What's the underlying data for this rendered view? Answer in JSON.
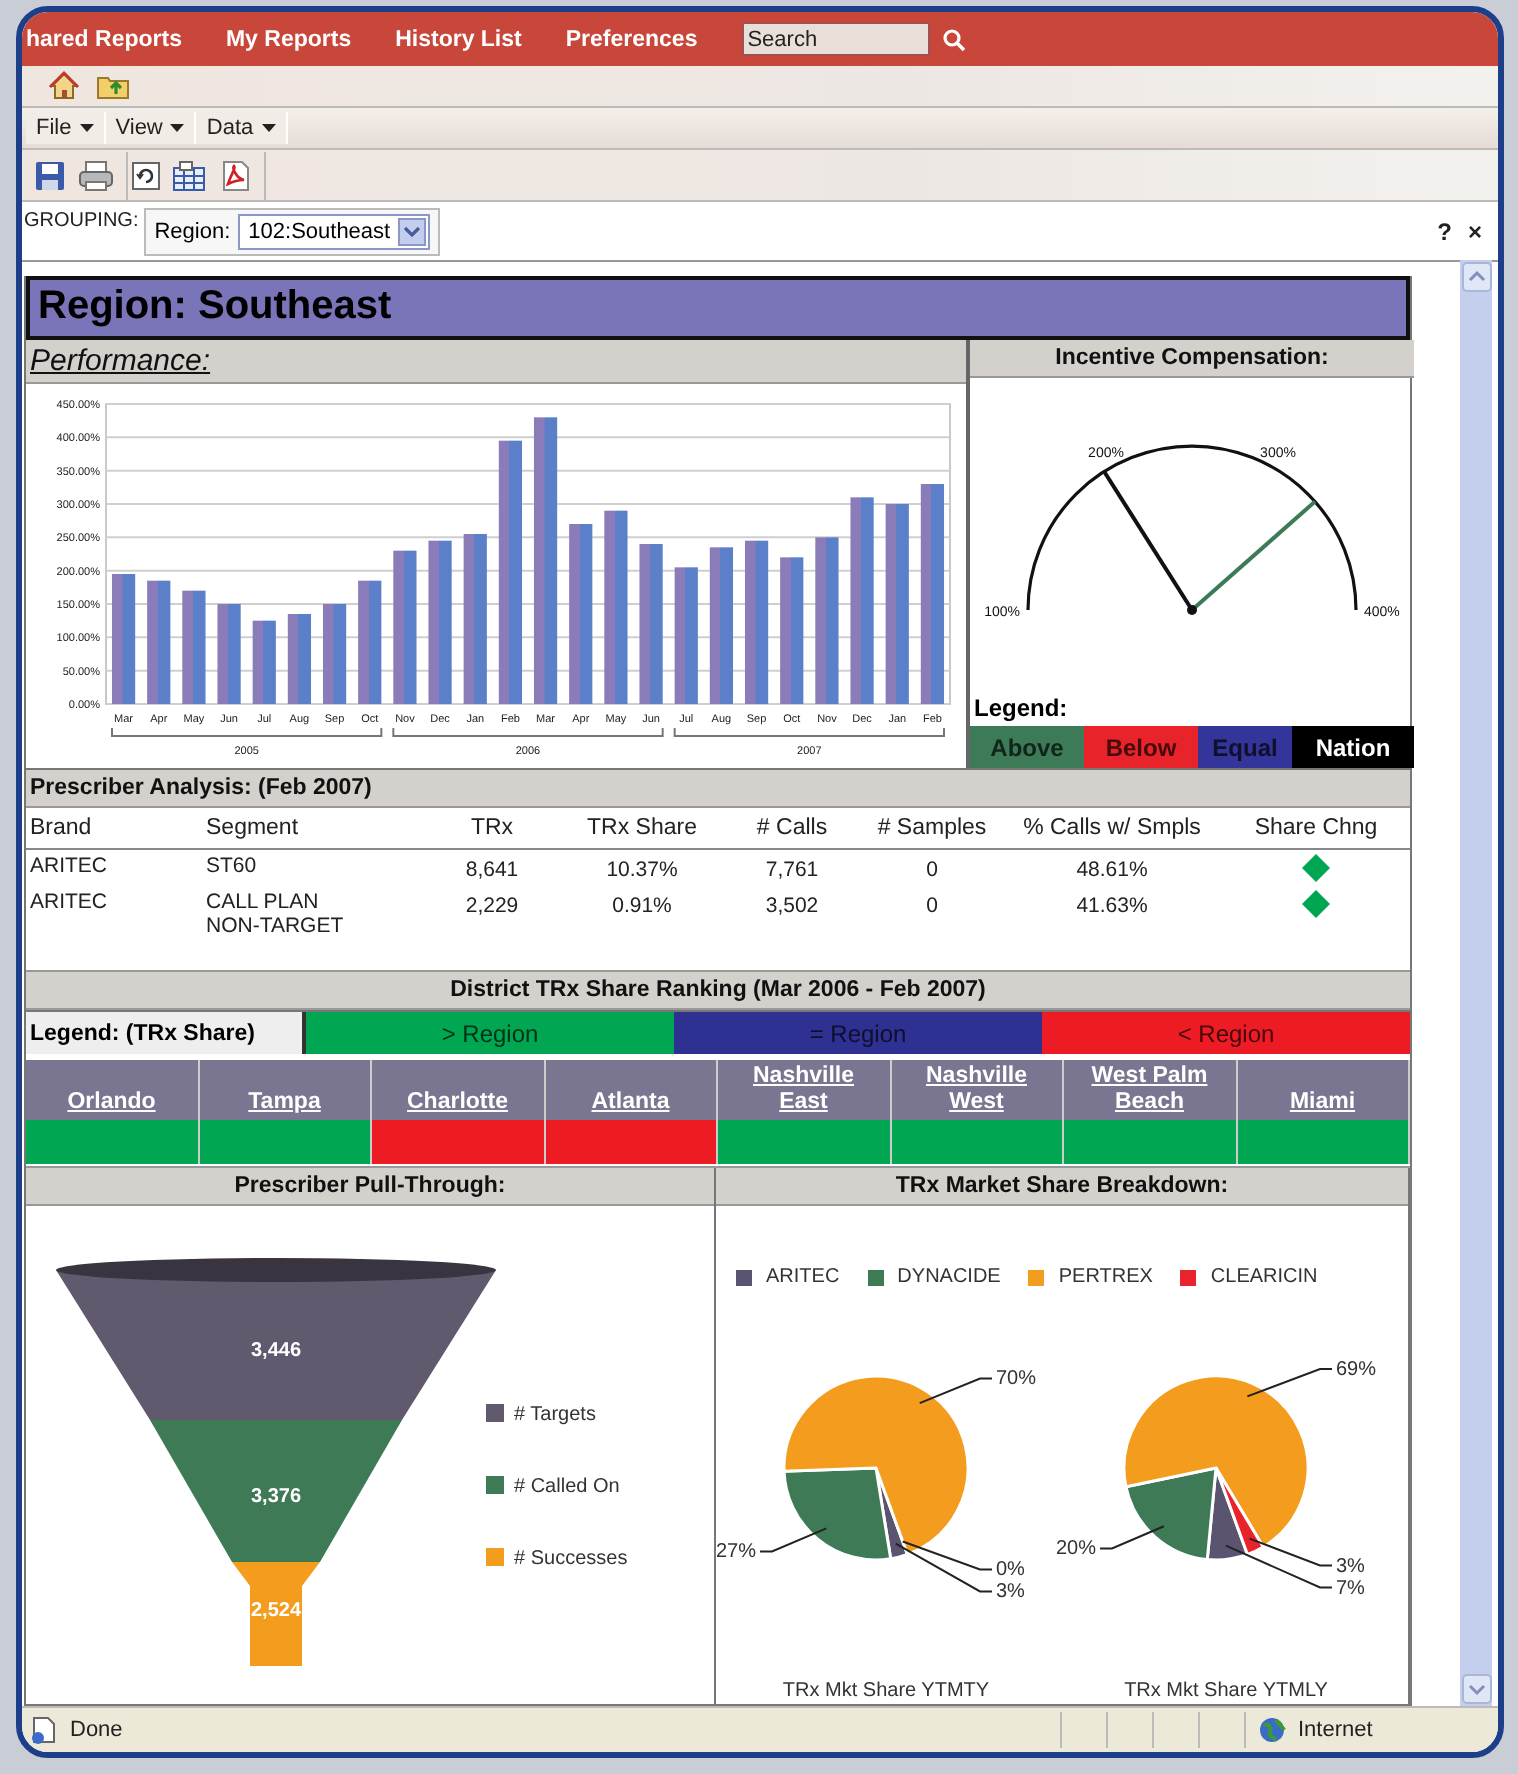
{
  "nav": {
    "tabs": [
      "hared Reports",
      "My Reports",
      "History List",
      "Preferences"
    ],
    "search": {
      "value": "Search"
    }
  },
  "menus": [
    "File",
    "View",
    "Data"
  ],
  "grouping": {
    "label": "GROUPING:",
    "field_label": "Region:",
    "value": "102:Southeast"
  },
  "panel_controls": [
    "?",
    "×"
  ],
  "report": {
    "title": "Region: Southeast",
    "performance": {
      "title": "Performance:",
      "chart_data": {
        "type": "bar",
        "categories": [
          "Mar",
          "Apr",
          "May",
          "Jun",
          "Jul",
          "Aug",
          "Sep",
          "Oct",
          "Nov",
          "Dec",
          "Jan",
          "Feb",
          "Mar",
          "Apr",
          "May",
          "Jun",
          "Jul",
          "Aug",
          "Sep",
          "Oct",
          "Nov",
          "Dec",
          "Jan",
          "Feb"
        ],
        "grid": true,
        "series": [
          {
            "color": "#5b7fc8",
            "values": [
              195,
              185,
              170,
              150,
              125,
              135,
              150,
              185,
              230,
              245,
              255,
              395,
              430,
              270,
              290,
              240,
              205,
              235,
              245,
              220,
              250,
              310,
              300,
              330
            ]
          }
        ],
        "ylim": [
          0,
          450
        ],
        "yticks": [
          {
            "value": 0,
            "label": "0.00%"
          },
          {
            "value": 50,
            "label": "50.00%"
          },
          {
            "value": 100,
            "label": "100.00%"
          },
          {
            "value": 150,
            "label": "150.00%"
          },
          {
            "value": 200,
            "label": "200.00%"
          },
          {
            "value": 250,
            "label": "250.00%"
          },
          {
            "value": 300,
            "label": "300.00%"
          },
          {
            "value": 350,
            "label": "350.00%"
          },
          {
            "value": 400,
            "label": "400.00%"
          },
          {
            "value": 450,
            "label": "450.00%"
          }
        ],
        "annotations": [
          "2005",
          "2006",
          "2007"
        ]
      }
    },
    "incentive": {
      "title": "Incentive Compensation:",
      "gauge": {
        "ticks": [
          "100%",
          "200%",
          "300%",
          "400%"
        ],
        "needles": [
          {
            "level": 0.32,
            "color": "#111111"
          },
          {
            "level": 0.77,
            "color": "#3d7a57"
          }
        ]
      },
      "legend_title": "Legend:",
      "legend": [
        {
          "label": "Above",
          "color": "#3d7a57"
        },
        {
          "label": "Below",
          "color": "#e8242a"
        },
        {
          "label": "Equal",
          "color": "#34359a"
        },
        {
          "label": "Nation",
          "color": "#000000"
        }
      ]
    },
    "prescriber": {
      "title": "Prescriber Analysis: (Feb 2007)",
      "columns": [
        "Brand",
        "Segment",
        "TRx",
        "TRx Share",
        "# Calls",
        "# Samples",
        "% Calls w/ Smpls",
        "Share Chng"
      ],
      "rows": [
        {
          "cells": [
            "ARITEC",
            "ST60",
            "8,641",
            "10.37%",
            "7,761",
            "0",
            "48.61%"
          ],
          "share_chng": {
            "color": "#00a651"
          }
        },
        {
          "cells": [
            "ARITEC",
            "CALL PLAN NON-TARGET",
            "2,229",
            "0.91%",
            "3,502",
            "0",
            "41.63%"
          ],
          "share_chng": {
            "color": "#00a651"
          }
        }
      ]
    },
    "district": {
      "title": "District TRx Share Ranking (Mar 2006 - Feb 2007)",
      "legend_label": "Legend: (TRx Share)",
      "legend": [
        {
          "label": "> Region",
          "color": "#00a651"
        },
        {
          "label": "= Region",
          "color": "#2e3192"
        },
        {
          "label": "< Region",
          "color": "#ed1c24"
        }
      ],
      "districts": [
        {
          "name": "Orlando",
          "color": "#00a651"
        },
        {
          "name": "Tampa",
          "color": "#00a651"
        },
        {
          "name": "Charlotte",
          "color": "#ed1c24"
        },
        {
          "name": "Atlanta",
          "color": "#ed1c24"
        },
        {
          "name": "Nashville East",
          "color": "#00a651"
        },
        {
          "name": "Nashville West",
          "color": "#00a651"
        },
        {
          "name": "West Palm Beach",
          "color": "#00a651"
        },
        {
          "name": "Miami",
          "color": "#00a651"
        }
      ]
    },
    "pull_through": {
      "title": "Prescriber Pull-Through:",
      "segments": [
        {
          "label": "# Targets",
          "value": "3,446",
          "color": "#615a6e"
        },
        {
          "label": "# Called On",
          "value": "3,376",
          "color": "#3f7a57"
        },
        {
          "label": "# Successes",
          "value": "2,524",
          "color": "#f39c1e"
        }
      ]
    },
    "market_share": {
      "title": "TRx Market Share Breakdown:",
      "legend": [
        {
          "name": "ARITEC",
          "color": "#5b5470"
        },
        {
          "name": "DYNACIDE",
          "color": "#3f7a57"
        },
        {
          "name": "PERTREX",
          "color": "#f39c1e"
        },
        {
          "name": "CLEARICIN",
          "color": "#e8242a"
        }
      ],
      "pies": [
        {
          "chart_data": {
            "type": "pie",
            "title": "TRx Mkt Share YTMTY",
            "values": [
              3,
              27,
              70,
              0
            ],
            "value_labels": [
              "3%",
              "27%",
              "70%",
              "0%"
            ]
          }
        },
        {
          "chart_data": {
            "type": "pie",
            "title": "TRx Mkt Share YTMLY",
            "values": [
              7,
              20,
              69,
              3
            ],
            "value_labels": [
              "7%",
              "20%",
              "69%",
              "3%"
            ]
          }
        }
      ]
    }
  },
  "status_bar": {
    "text": "Done",
    "zone": "Internet"
  }
}
